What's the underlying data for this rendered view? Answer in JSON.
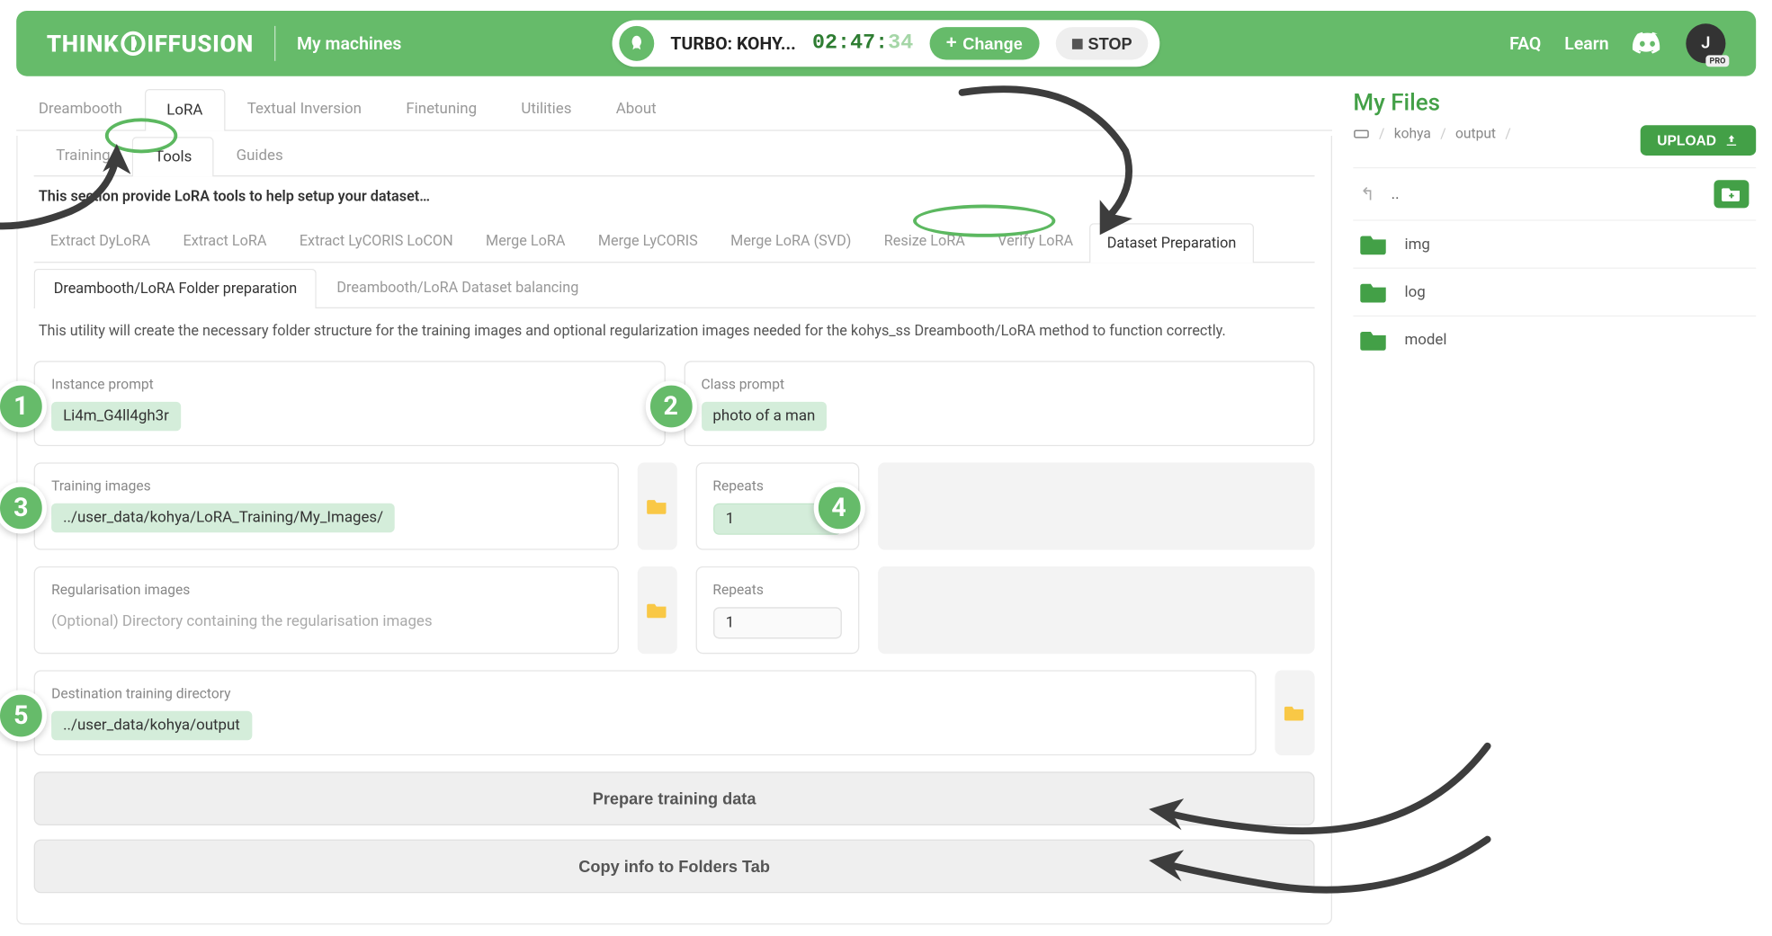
{
  "brand": {
    "part1": "THINK",
    "part2": "IFFUSION"
  },
  "header": {
    "my_machines": "My machines",
    "machine_name": "TURBO: KOHY...",
    "timer_h": "02",
    "timer_m": "47",
    "timer_s": "34",
    "change_label": "Change",
    "stop_label": "STOP",
    "faq": "FAQ",
    "learn": "Learn",
    "avatar_initial": "J",
    "avatar_badge": "PRO"
  },
  "top_tabs": [
    "Dreambooth",
    "LoRA",
    "Textual Inversion",
    "Finetuning",
    "Utilities",
    "About"
  ],
  "top_tab_active": 1,
  "sub_tabs": [
    "Training",
    "Tools",
    "Guides"
  ],
  "sub_tab_active": 1,
  "section_desc": "This section provide LoRA tools to help setup your dataset…",
  "tool_tabs": [
    "Extract DyLoRA",
    "Extract LoRA",
    "Extract LyCORIS LoCON",
    "Merge LoRA",
    "Merge LyCORIS",
    "Merge LoRA (SVD)",
    "Resize LoRA",
    "Verify LoRA",
    "Dataset Preparation"
  ],
  "tool_tab_active": 8,
  "inner_tabs": [
    "Dreambooth/LoRA Folder preparation",
    "Dreambooth/LoRA Dataset balancing"
  ],
  "inner_tab_active": 0,
  "util_desc": "This utility will create the necessary folder structure for the training images and optional regularization images needed for the kohys_ss Dreambooth/LoRA method to function correctly.",
  "fields": {
    "instance_prompt": {
      "label": "Instance prompt",
      "value": "Li4m_G4ll4gh3r"
    },
    "class_prompt": {
      "label": "Class prompt",
      "value": "photo of a man"
    },
    "training_images": {
      "label": "Training images",
      "value": "../user_data/kohya/LoRA_Training/My_Images/"
    },
    "repeats1": {
      "label": "Repeats",
      "value": "1"
    },
    "reg_images": {
      "label": "Regularisation images",
      "placeholder": "(Optional) Directory containing the regularisation images"
    },
    "repeats2": {
      "label": "Repeats",
      "value": "1"
    },
    "dest_dir": {
      "label": "Destination training directory",
      "value": "../user_data/kohya/output"
    }
  },
  "buttons": {
    "prepare": "Prepare training data",
    "copy": "Copy info to Folders Tab"
  },
  "files": {
    "title": "My Files",
    "breadcrumb": [
      "kohya",
      "output"
    ],
    "upload_label": "UPLOAD",
    "parent": "..",
    "items": [
      "img",
      "log",
      "model"
    ]
  },
  "annotations": {
    "n1": "1",
    "n2": "2",
    "n3": "3",
    "n4": "4",
    "n5": "5"
  }
}
